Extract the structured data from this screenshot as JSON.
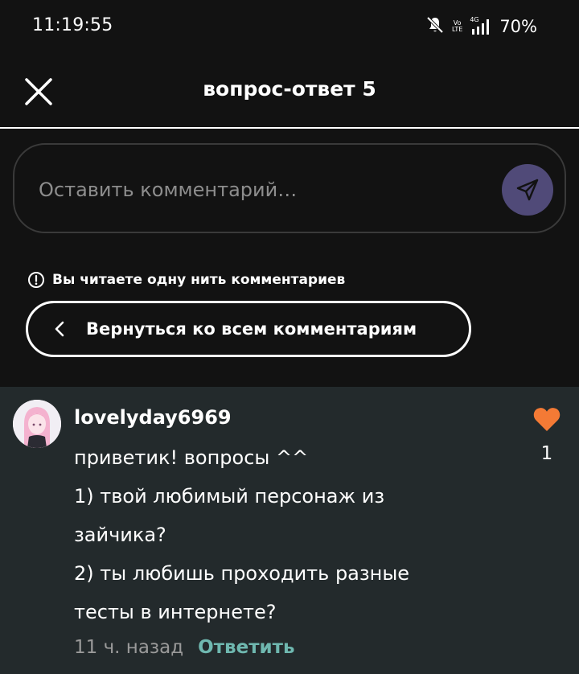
{
  "status_bar": {
    "time": "11:19:55",
    "volte_label_top": "Vo",
    "volte_label_bottom": "LTE",
    "network_label": "4G",
    "battery": "70%"
  },
  "header": {
    "title": "вопрос-ответ 5"
  },
  "comment_input": {
    "placeholder": "Оставить комментарий…"
  },
  "thread_notice": {
    "text": "Вы читаете одну нить комментариев"
  },
  "back_button": {
    "label": "Вернуться ко всем комментариям"
  },
  "comment": {
    "username": "lovelyday6969",
    "lines": [
      "приветик! вопросы ^^",
      "1) твой любимый персонаж из",
      "зайчика?",
      "2) ты любишь проходить разные",
      "тесты в интернете?"
    ],
    "time_ago": "11 ч. назад",
    "reply_label": "Ответить",
    "like_count": "1"
  },
  "colors": {
    "background": "#121212",
    "card": "#232a2c",
    "send_button": "#504a78",
    "like_heart": "#f47a35",
    "reply_accent": "#6fb8b0"
  }
}
